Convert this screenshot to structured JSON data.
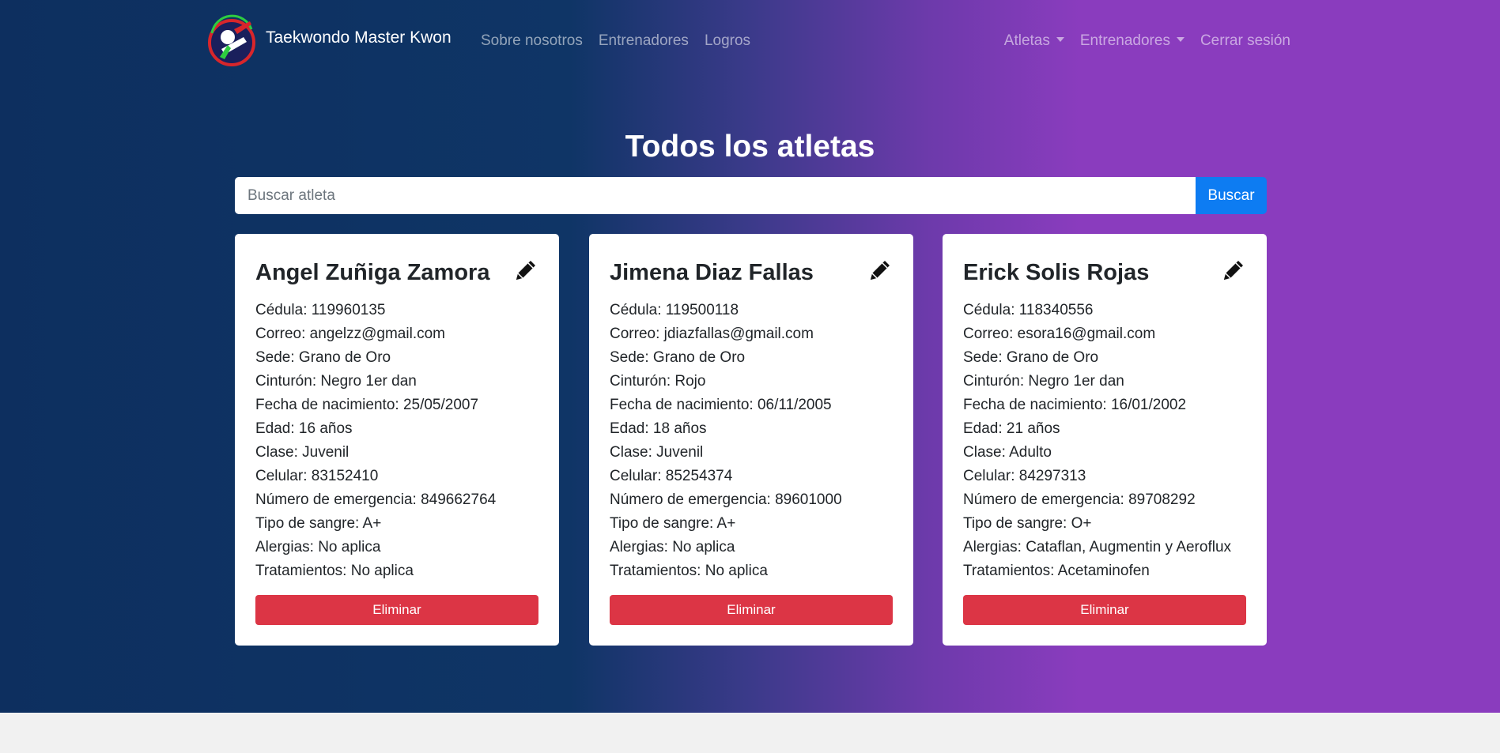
{
  "navbar": {
    "brand": "Taekwondo Master Kwon",
    "logo_icon": "taekwondo-logo",
    "left_links": [
      "Sobre nosotros",
      "Entrenadores",
      "Logros"
    ],
    "right_links": [
      {
        "label": "Atletas",
        "dropdown": true
      },
      {
        "label": "Entrenadores",
        "dropdown": true
      },
      {
        "label": "Cerrar sesión",
        "dropdown": false
      }
    ]
  },
  "page": {
    "title": "Todos los atletas"
  },
  "search": {
    "placeholder": "Buscar atleta",
    "value": "",
    "button_label": "Buscar"
  },
  "athletes": [
    {
      "name": "Angel Zuñiga Zamora",
      "fields": [
        "Cédula: 119960135",
        "Correo: angelzz@gmail.com",
        "Sede: Grano de Oro",
        "Cinturón: Negro 1er dan",
        "Fecha de nacimiento: 25/05/2007",
        "Edad: 16 años",
        "Clase: Juvenil",
        "Celular: 83152410",
        "Número de emergencia: 849662764",
        "Tipo de sangre: A+",
        "Alergias: No aplica",
        "Tratamientos: No aplica"
      ],
      "delete_label": "Eliminar"
    },
    {
      "name": "Jimena Diaz Fallas",
      "fields": [
        "Cédula: 119500118",
        "Correo: jdiazfallas@gmail.com",
        "Sede: Grano de Oro",
        "Cinturón: Rojo",
        "Fecha de nacimiento: 06/11/2005",
        "Edad: 18 años",
        "Clase: Juvenil",
        "Celular: 85254374",
        "Número de emergencia: 89601000",
        "Tipo de sangre: A+",
        "Alergias: No aplica",
        "Tratamientos: No aplica"
      ],
      "delete_label": "Eliminar"
    },
    {
      "name": "Erick Solis Rojas",
      "fields": [
        "Cédula: 118340556",
        "Correo: esora16@gmail.com",
        "Sede: Grano de Oro",
        "Cinturón: Negro 1er dan",
        "Fecha de nacimiento: 16/01/2002",
        "Edad: 21 años",
        "Clase: Adulto",
        "Celular: 84297313",
        "Número de emergencia: 89708292",
        "Tipo de sangre: O+",
        "Alergias: Cataflan, Augmentin y Aeroflux",
        "Tratamientos: Acetaminofen"
      ],
      "delete_label": "Eliminar"
    }
  ],
  "colors": {
    "gradient_start": "#0d2f5f",
    "gradient_end": "#8a3cbe",
    "primary": "#0d7cf2",
    "danger": "#dc3545",
    "card_bg": "#ffffff",
    "footer_bg": "#f1f1f1"
  }
}
